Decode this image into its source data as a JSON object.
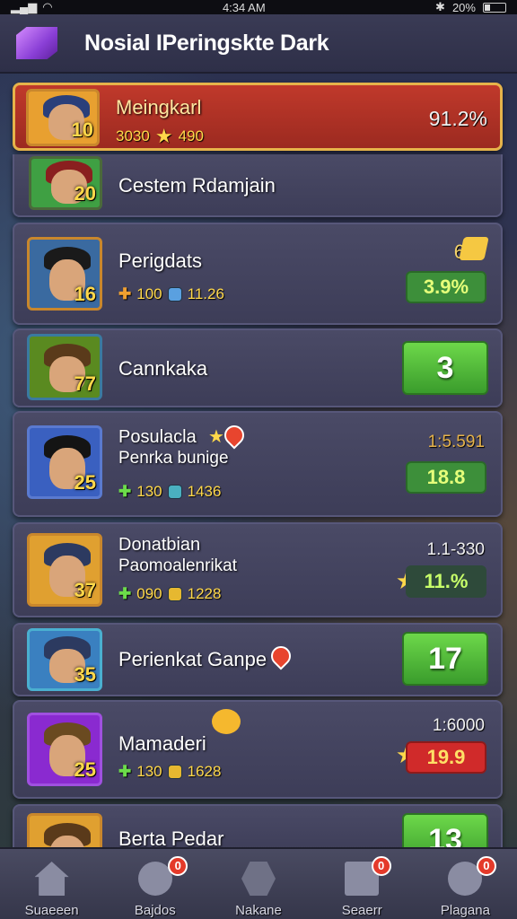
{
  "status": {
    "time": "4:34 AM",
    "battery": "20%"
  },
  "header": {
    "title": "Nosial IPeringskte Dark"
  },
  "rows": [
    {
      "name": "Meingkarl",
      "level": "10",
      "stat1": "3030",
      "stat2": "490",
      "right": "91.2%",
      "highlight": true,
      "hair": "#2a3f7a",
      "bg": "#e8a030"
    },
    {
      "name": "Cestem Rdamjain",
      "level": "20",
      "hair": "#8a1f1f",
      "bg": "#3fa043"
    },
    {
      "name": "Perigdats",
      "level": "16",
      "stat1": "100",
      "stat2": "11.26",
      "right_top": "6",
      "right": "3.9%",
      "hair": "#1a1a1a",
      "bg": "#3a6aa0"
    },
    {
      "name": "Cannkaka",
      "level": "77",
      "right": "3",
      "hair": "#5a3a1a",
      "bg": "#5a8a20"
    },
    {
      "name": "Posulacla",
      "sub": "Penrka bunige",
      "level": "25",
      "stat1": "130",
      "stat2": "1436",
      "right_top": "1:5.591",
      "right": "18.8",
      "hair": "#141414",
      "bg": "#3a60c0"
    },
    {
      "name": "Donatbian",
      "sub": "Paomoalenrikat",
      "level": "37",
      "stat1": "090",
      "stat2": "1228",
      "right_top": "1.1-330",
      "right": "11.%",
      "hair": "#2c3a60",
      "bg": "#e0a030"
    },
    {
      "name": "Perienkat Ganpe",
      "level": "35",
      "right": "17",
      "hair": "#2c3a60",
      "bg": "#3a80c0"
    },
    {
      "name": "Mamaderi",
      "level": "25",
      "stat1": "130",
      "stat2": "1628",
      "right_top": "1:6000",
      "right": "19.9",
      "hair": "#6a4a20",
      "bg": "#8a2ad0"
    },
    {
      "name": "Berta Pedar",
      "right": "13",
      "hair": "#5a3a1a",
      "bg": "#e0a030"
    }
  ],
  "nav": [
    {
      "label": "Suaeeen",
      "icon": "home-icon"
    },
    {
      "label": "Bajdos",
      "icon": "chat-icon",
      "badge": "0"
    },
    {
      "label": "Nakane",
      "icon": "hexagon-icon"
    },
    {
      "label": "Seaerr",
      "icon": "flag-icon",
      "badge": "0"
    },
    {
      "label": "Plagana",
      "icon": "profile-icon",
      "badge": "0"
    }
  ],
  "colors": {
    "highlight": "#c0392b",
    "green": "#4caf50",
    "gold": "#e6b34a"
  }
}
